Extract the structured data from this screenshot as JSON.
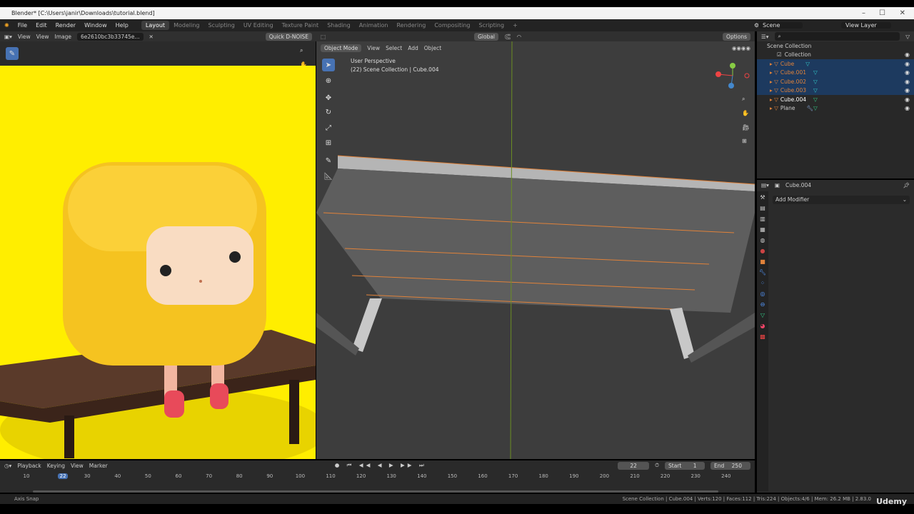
{
  "window": {
    "title": "Blender* [C:\\Users\\janir\\Downloads\\tutorial.blend]"
  },
  "menu": [
    "File",
    "Edit",
    "Render",
    "Window",
    "Help"
  ],
  "workspaces": [
    "Layout",
    "Modeling",
    "Sculpting",
    "UV Editing",
    "Texture Paint",
    "Shading",
    "Animation",
    "Rendering",
    "Compositing",
    "Scripting"
  ],
  "active_workspace": "Layout",
  "scene": "Scene",
  "view_layer": "View Layer",
  "image_editor": {
    "view_menu": "View",
    "view2": "View",
    "image": "Image",
    "image_name": "6e2610bc3b33745e...",
    "denoise": "Quick D-NOISE"
  },
  "viewport": {
    "mode": "Object Mode",
    "menus": [
      "View",
      "Select",
      "Add",
      "Object"
    ],
    "orientation": "Global",
    "options": "Options",
    "perspective": "User Perspective",
    "info": "(22) Scene Collection | Cube.004"
  },
  "outliner": {
    "root": "Scene Collection",
    "collection": "Collection",
    "items": [
      {
        "name": "Cube",
        "selected": true
      },
      {
        "name": "Cube.001",
        "selected": true
      },
      {
        "name": "Cube.002",
        "selected": true
      },
      {
        "name": "Cube.003",
        "selected": true
      },
      {
        "name": "Cube.004",
        "selected": false
      },
      {
        "name": "Plane",
        "selected": false
      }
    ]
  },
  "properties": {
    "object": "Cube.004",
    "add_modifier": "Add Modifier"
  },
  "timeline": {
    "menus": [
      "Playback",
      "Keying",
      "View",
      "Marker"
    ],
    "current": "22",
    "start_label": "Start",
    "start": "1",
    "end_label": "End",
    "end": "250",
    "ticks": [
      "10",
      "22",
      "30",
      "40",
      "50",
      "60",
      "70",
      "80",
      "90",
      "100",
      "110",
      "120",
      "130",
      "140",
      "150",
      "160",
      "170",
      "180",
      "190",
      "200",
      "210",
      "220",
      "230",
      "240"
    ]
  },
  "status": {
    "left": "Axis Snap",
    "right": "Scene Collection | Cube.004 | Verts:120 | Faces:112 | Tris:224 | Objects:4/6 | Mem: 26.2 MB | 2.83.0"
  },
  "watermark": "Udemy",
  "colors": {
    "accent": "#4772b3",
    "selection": "#1d3a5f",
    "orange": "#e0823a"
  }
}
